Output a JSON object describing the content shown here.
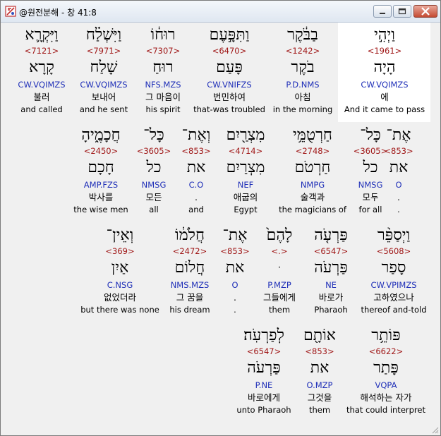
{
  "window": {
    "title": "@원전분해 - 창 41:8"
  },
  "colors": {
    "strong": "#a01818",
    "morph": "#2030b8",
    "highlight": "#ffffff"
  },
  "rows": [
    {
      "words": [
        {
          "heb": "וַיְהִ֣י",
          "strong": "<1961>",
          "lemma": "הָיָה",
          "morph": "CW.VQIMZS",
          "kor": "에",
          "eng": "And it came to pass"
        },
        {
          "heb": "בַבֹּ֔קֶר",
          "strong": "<1242>",
          "lemma": "בֹקֶר",
          "morph": "P.D.NMS",
          "kor": "아침",
          "eng": "in the morning"
        },
        {
          "heb": "וַתִּפָּ֣עֶם",
          "strong": "<6470>",
          "lemma": "פָּעַם",
          "morph": "CW.VNIFZS",
          "kor": "번민하여",
          "eng": "that-was troubled"
        },
        {
          "heb": "רוּח֔וֹ",
          "strong": "<7307>",
          "lemma": "רוּחַ",
          "morph": "NFS.MZS",
          "kor": "그 마음이",
          "eng": "his spirit"
        },
        {
          "heb": "וַיִּשְׁלַ֗ח",
          "strong": "<7971>",
          "lemma": "שָׁלַח",
          "morph": "CW.VQIMZS",
          "kor": "보내어",
          "eng": "and he sent"
        },
        {
          "heb": "וַיִּקְרָ֛א",
          "strong": "<7121>",
          "lemma": "קָרָא",
          "morph": "CW.VQIMZS",
          "kor": "불러",
          "eng": "and called"
        }
      ]
    },
    {
      "words": [
        {
          "heb": "אֶת־",
          "strong": "<853>",
          "lemma": "את",
          "morph": "O",
          "kor": ".",
          "eng": "."
        },
        {
          "heb": "כָּל־",
          "strong": "<3605>",
          "lemma": "כל",
          "morph": "NMSG",
          "kor": "모두",
          "eng": "for all"
        },
        {
          "heb": "חַרְטֻמֵּ֥י",
          "strong": "<2748>",
          "lemma": "חַרְטֹם",
          "morph": "NMPG",
          "kor": "술객과",
          "eng": "the magicians of"
        },
        {
          "heb": "מִצְרַ֖יִם",
          "strong": "<4714>",
          "lemma": "מִצְרַיִם",
          "morph": "NEF",
          "kor": "애굽의",
          "eng": "Egypt"
        },
        {
          "heb": "וְאֶת־",
          "strong": "<853>",
          "lemma": "את",
          "morph": "C.O",
          "kor": ".",
          "eng": "and"
        },
        {
          "heb": "כָּל־",
          "strong": "<3605>",
          "lemma": "כל",
          "morph": "NMSG",
          "kor": "모든",
          "eng": "all"
        },
        {
          "heb": "חֲכָמֶ֑יהָ",
          "strong": "<2450>",
          "lemma": "חָכָם",
          "morph": "AMP.FZS",
          "kor": "박사를",
          "eng": "the wise men"
        }
      ]
    },
    {
      "words": [
        {
          "heb": "וַיְסַפֵּ֨ר",
          "strong": "<5608>",
          "lemma": "סָפַר",
          "morph": "CW.VPIMZS",
          "kor": "고하였으나",
          "eng": "thereof and-told"
        },
        {
          "heb": "פַּרְעֹ֤ה",
          "strong": "<6547>",
          "lemma": "פַּרְעֹה",
          "morph": "NE",
          "kor": "바로가",
          "eng": "Pharaoh"
        },
        {
          "heb": "לָהֶם֙",
          "strong": "<.>",
          "lemma": "ּ",
          "morph": "P.MZP",
          "kor": "그들에게",
          "eng": "them"
        },
        {
          "heb": "אֶת־",
          "strong": "<853>",
          "lemma": "את",
          "morph": "O",
          "kor": ".",
          "eng": "."
        },
        {
          "heb": "חֲלֹמ֔וֹ",
          "strong": "<2472>",
          "lemma": "חֲלוֹם",
          "morph": "NMS.MZS",
          "kor": "그 꿈을",
          "eng": "his dream"
        },
        {
          "heb": "וְאֵין־",
          "strong": "<369>",
          "lemma": "אַיִן",
          "morph": "C.NSG",
          "kor": "없었더라",
          "eng": "but there was none"
        }
      ]
    },
    {
      "words": [
        {
          "heb": "פּוֹתֵ֥ר",
          "strong": "<6622>",
          "lemma": "פָּתַר",
          "morph": "VQPA",
          "kor": "해석하는 자가",
          "eng": "that could interpret"
        },
        {
          "heb": "אוֹתָ֖ם",
          "strong": "<853>",
          "lemma": "את",
          "morph": "O.MZP",
          "kor": "그것을",
          "eng": "them"
        },
        {
          "heb": "לְפַרְעֹֽה׃",
          "strong": "<6547>",
          "lemma": "פַּרְעֹה",
          "morph": "P.NE",
          "kor": "바로에게",
          "eng": "unto Pharaoh"
        }
      ]
    }
  ]
}
